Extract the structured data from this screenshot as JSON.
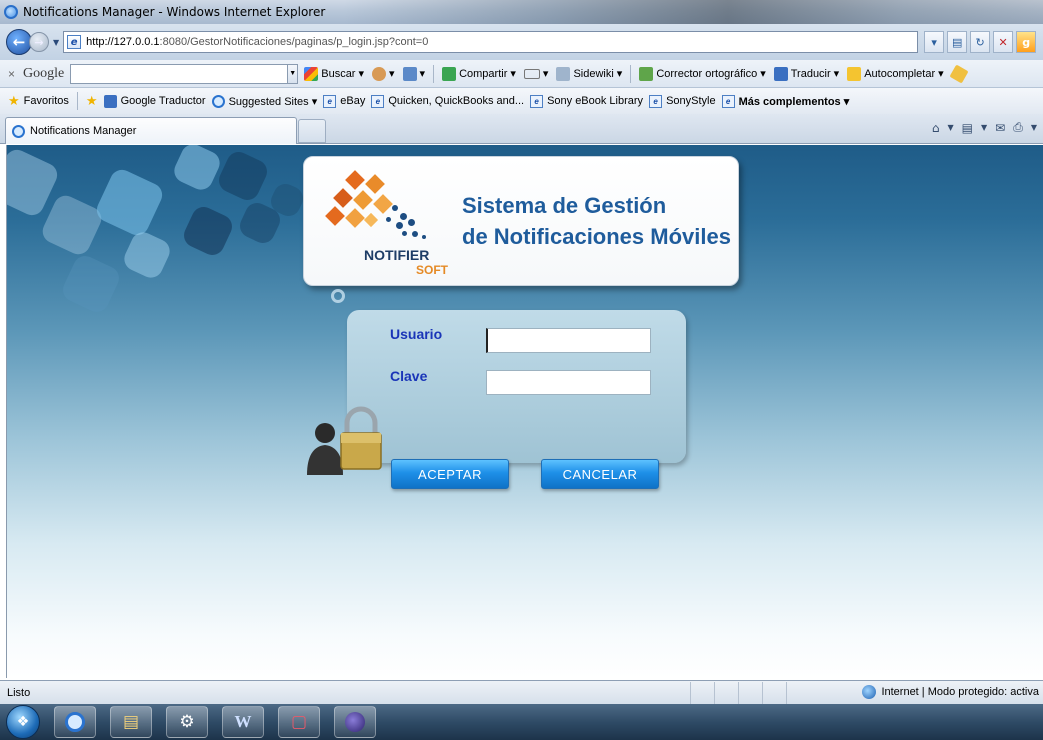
{
  "window": {
    "title": "Notifications Manager - Windows Internet Explorer"
  },
  "address": {
    "url_host": "http://127.0.0.1",
    "url_rest": ":8080/GestorNotificaciones/paginas/p_login.jsp?cont=0"
  },
  "google_toolbar": {
    "close": "×",
    "logo": "Google",
    "buscar": "Buscar",
    "compartir": "Compartir",
    "sidewiki": "Sidewiki",
    "corrector": "Corrector ortográfico",
    "traducir": "Traducir",
    "autocompletar": "Autocompletar"
  },
  "favorites": {
    "favoritos": "Favoritos",
    "items": [
      "Google Traductor",
      "Suggested Sites ▾",
      "eBay",
      "Quicken, QuickBooks and...",
      "Sony eBook Library",
      "SonyStyle",
      "Más complementos ▾"
    ]
  },
  "tab": {
    "label": "Notifications Manager"
  },
  "app": {
    "brand_line1": "NOTIFIER",
    "brand_line2": "SOFT",
    "system_title_line1": "Sistema de Gestión",
    "system_title_line2": "de Notificaciones Móviles",
    "usuario_label": "Usuario",
    "clave_label": "Clave",
    "usuario_value": "",
    "clave_value": "",
    "accept_label": "ACEPTAR",
    "cancel_label": "CANCELAR"
  },
  "status": {
    "text": "Listo",
    "zone": "Internet | Modo protegido: activa"
  },
  "colors": {
    "accent_blue": "#1f5c9c",
    "label_blue": "#1a35b8",
    "brand_orange": "#e58a26",
    "button_blue": "#1e90e8"
  }
}
